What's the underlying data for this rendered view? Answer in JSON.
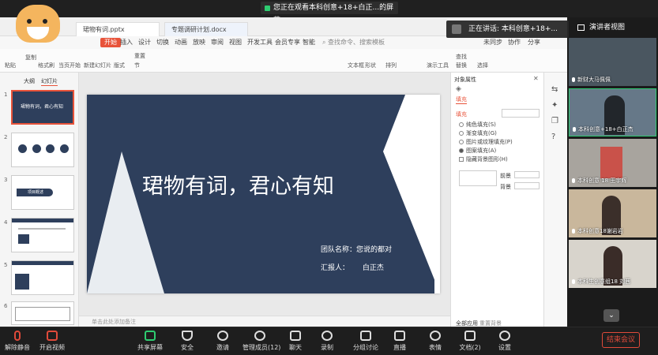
{
  "meeting": {
    "sharing_banner": "您正在观看本科创意+18+白正...的屏幕",
    "speaker_popup": "正在讲话: 本科创意+18+...",
    "presenter_view": "演讲者视图",
    "end_meeting": "结束会议"
  },
  "ppt": {
    "tabs": [
      "珺物有词.pptx",
      "专题调研计划.docx"
    ],
    "ribbon_tabs": [
      "开始",
      "插入",
      "设计",
      "切换",
      "动画",
      "放映",
      "审阅",
      "视图",
      "开发工具",
      "会员专享",
      "智能"
    ],
    "ribbon_active": "开始",
    "search_placeholder": "查找命令、搜索模板",
    "top_right": [
      "未同步",
      "协作",
      "分享"
    ],
    "ribbon_buttons": [
      "粘贴",
      "复制",
      "格式刷",
      "当页开始",
      "新建幻灯片",
      "版式",
      "节",
      "重置",
      "文本框",
      "形状",
      "排列",
      "演示工具",
      "替换",
      "查找",
      "选择"
    ],
    "panel_tabs": [
      "大纲",
      "幻灯片"
    ],
    "slide_numbers": [
      "1",
      "2",
      "3",
      "4",
      "5",
      "6"
    ],
    "thumb_3_label": "项目概述",
    "notes_placeholder": "单击此处添加备注",
    "slide": {
      "title": "珺物有词，君心有知",
      "team_label": "团队名称：",
      "team_value": "您说的都对",
      "reporter_label": "汇报人：",
      "reporter_value": "白正杰",
      "dark_color": "#2e3f5c"
    },
    "props": {
      "header": "对象属性",
      "tab": "填充",
      "section": "填充",
      "options": [
        "纯色填充(S)",
        "渐变填充(G)",
        "图片或纹理填充(P)",
        "图案填充(A)"
      ],
      "selected_index": 3,
      "hide_bg": "隐藏背景图形(H)",
      "fore_label": "前景",
      "back_label": "背景",
      "apply_all": "全部应用",
      "reset_bg": "重置背景"
    }
  },
  "participants": [
    {
      "name": "新财大马佩佩"
    },
    {
      "name": "本科创意+18+白正杰"
    },
    {
      "name": "本科创意 18 王宇辉"
    },
    {
      "name": "本科创意18谢岩岩"
    },
    {
      "name": "本科生创意组18 刘茜"
    }
  ],
  "toolbar": {
    "mute": "解除静音",
    "video": "开启视频",
    "share": "共享屏幕",
    "security": "安全",
    "invite": "邀请",
    "members": "管理成员(12)",
    "chat": "聊天",
    "record": "录制",
    "breakout": "分组讨论",
    "live": "直播",
    "reaction": "表情",
    "docs": "文档(2)",
    "settings": "设置"
  },
  "colors": {
    "accent": "#e8533a",
    "end": "#e04a3a",
    "navy": "#2e3f5c"
  }
}
